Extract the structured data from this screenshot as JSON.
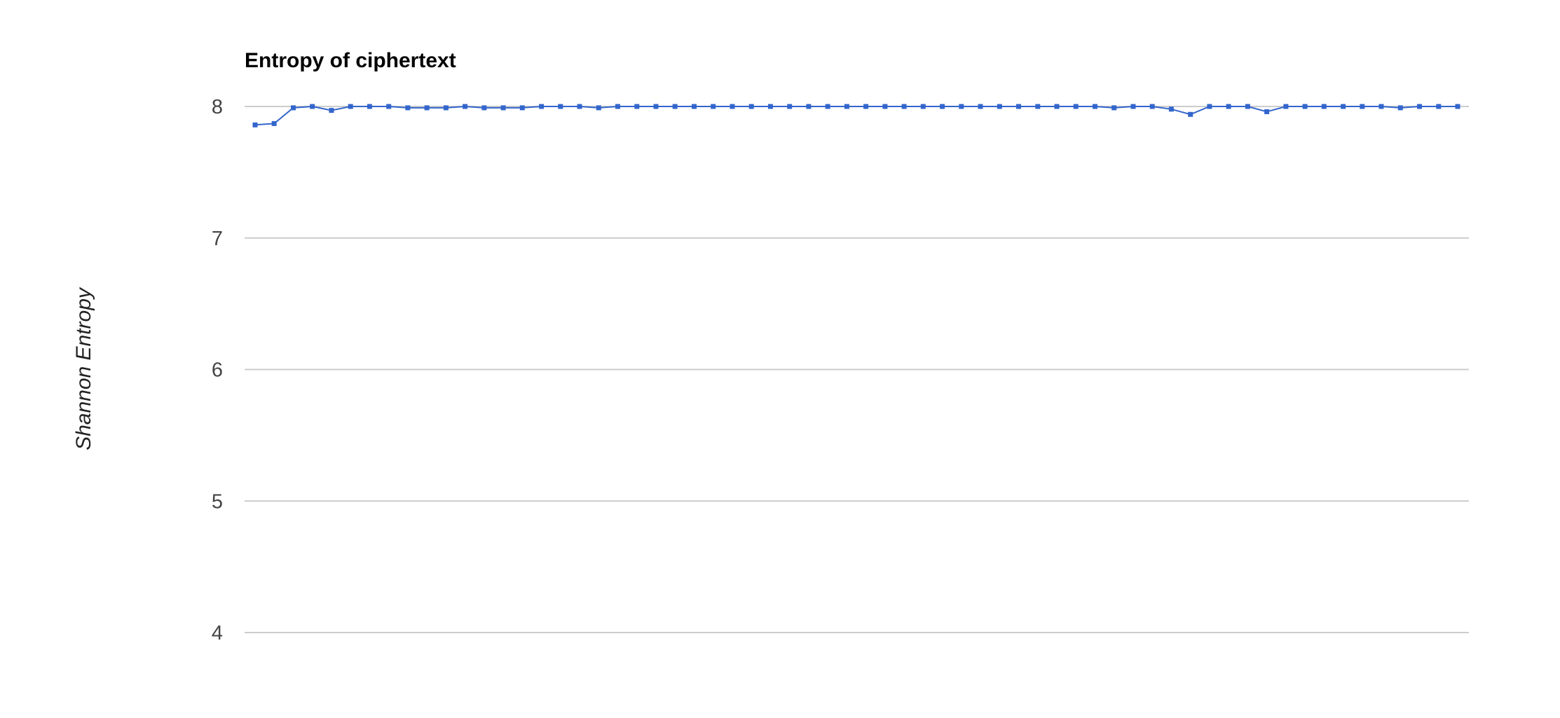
{
  "chart_data": {
    "type": "line",
    "title": "Entropy of ciphertext",
    "xlabel": "",
    "ylabel": "Shannon Entropy",
    "ylim": [
      4,
      8
    ],
    "yticks": [
      "4",
      "5",
      "6",
      "7",
      "8"
    ],
    "grid": true,
    "legend": "none",
    "colors": {
      "line": "#3366cc",
      "grid": "#cccccc",
      "text": "#444444"
    },
    "series": [
      {
        "values": [
          7.86,
          7.87,
          7.99,
          8.0,
          7.97,
          8.0,
          8.0,
          8.0,
          7.99,
          7.99,
          7.99,
          8.0,
          7.99,
          7.99,
          7.99,
          8.0,
          8.0,
          8.0,
          7.99,
          8.0,
          8.0,
          8.0,
          8.0,
          8.0,
          8.0,
          8.0,
          8.0,
          8.0,
          8.0,
          8.0,
          8.0,
          8.0,
          8.0,
          8.0,
          8.0,
          8.0,
          8.0,
          8.0,
          8.0,
          8.0,
          8.0,
          8.0,
          8.0,
          8.0,
          8.0,
          7.99,
          8.0,
          8.0,
          7.98,
          7.94,
          8.0,
          8.0,
          8.0,
          7.96,
          8.0,
          8.0,
          8.0,
          8.0,
          8.0,
          8.0,
          7.99,
          8.0,
          8.0,
          8.0
        ]
      }
    ]
  }
}
